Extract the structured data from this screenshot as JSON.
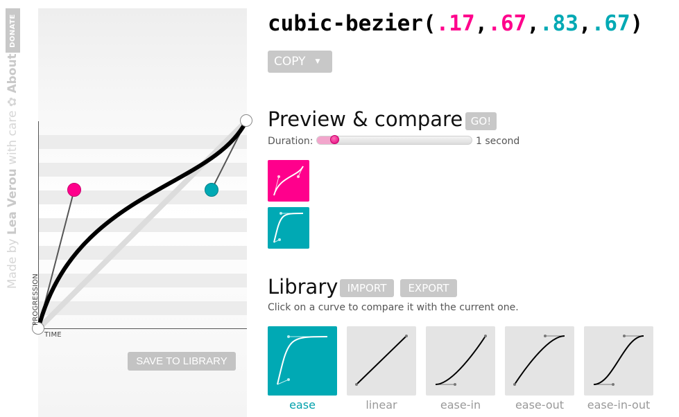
{
  "sidebar": {
    "donate_label": "DONATE",
    "credits_prefix": "Made by ",
    "credits_author": "Lea Verou",
    "credits_suffix": " with care ✿ ",
    "about_label": "About"
  },
  "editor": {
    "axis_progression": "PROGRESSION",
    "axis_time": "TIME",
    "save_label": "SAVE TO LIBRARY"
  },
  "header": {
    "fn_name": "cubic-bezier",
    "open_paren": "(",
    "close_paren": ")",
    "comma": ",",
    "p1x": ".17",
    "p1y": ".67",
    "p2x": ".83",
    "p2y": ".67",
    "copy_label": "COPY",
    "copy_caret": "▼"
  },
  "preview": {
    "heading": "Preview & compare",
    "go_label": "GO!",
    "duration_label": "Duration:",
    "duration_value": "1 second",
    "duration_seconds": 1
  },
  "library": {
    "heading": "Library",
    "import_label": "IMPORT",
    "export_label": "EXPORT",
    "description": "Click on a curve to compare it with the current one.",
    "items": [
      {
        "name": "ease"
      },
      {
        "name": "linear"
      },
      {
        "name": "ease-in"
      },
      {
        "name": "ease-out"
      },
      {
        "name": "ease-in-out"
      }
    ]
  },
  "colors": {
    "pink": "#ff008c",
    "teal": "#00a9b4",
    "button_gray": "#c8c8c8"
  }
}
